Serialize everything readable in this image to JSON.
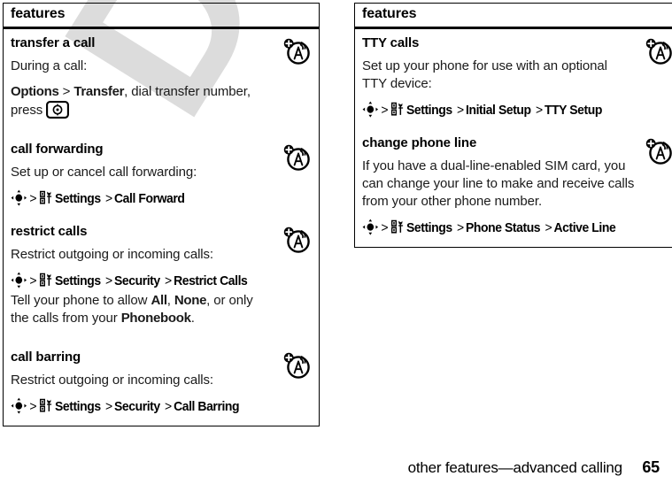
{
  "document": {
    "watermark_text": "DRAFT",
    "watermark_color": "#dcdcdc",
    "page_background": "#ffffff",
    "text_color": "#000000"
  },
  "footer": {
    "section_title": "other features—advanced calling",
    "page_number": "65"
  },
  "columns": [
    {
      "header": "features",
      "rows": [
        {
          "title": "transfer a call",
          "icon": "network-service-icon",
          "blocks": [
            {
              "kind": "para",
              "text": "During a call:"
            },
            {
              "kind": "rich",
              "segments": [
                {
                  "text": "Options",
                  "bold": true
                },
                {
                  "text": " > ",
                  "bold": false
                },
                {
                  "text": "Transfer",
                  "bold": true
                },
                {
                  "text": ", dial transfer number, press ",
                  "bold": false
                }
              ],
              "trailing_icon": "send-key-icon"
            }
          ]
        },
        {
          "title": "call forwarding",
          "icon": "network-service-icon",
          "blocks": [
            {
              "kind": "para",
              "text": "Set up or cancel call forwarding:"
            },
            {
              "kind": "path",
              "leading_icon": "nav-key-icon",
              "steps": [
                "Settings",
                "Call Forward"
              ],
              "menu_icon": "settings-icon"
            }
          ]
        },
        {
          "title": "restrict calls",
          "icon": "network-service-icon",
          "blocks": [
            {
              "kind": "para",
              "text": "Restrict outgoing or incoming calls:"
            },
            {
              "kind": "path",
              "leading_icon": "nav-key-icon",
              "steps": [
                "Settings",
                "Security",
                "Restrict Calls"
              ],
              "menu_icon": "settings-icon"
            },
            {
              "kind": "rich",
              "segments": [
                {
                  "text": "Tell your phone to allow ",
                  "bold": false
                },
                {
                  "text": "All",
                  "bold": true
                },
                {
                  "text": ", ",
                  "bold": false
                },
                {
                  "text": "None",
                  "bold": true
                },
                {
                  "text": ", or only the calls from your ",
                  "bold": false
                },
                {
                  "text": "Phonebook",
                  "bold": true
                },
                {
                  "text": ".",
                  "bold": false
                }
              ]
            }
          ]
        },
        {
          "title": "call barring",
          "icon": "network-service-icon",
          "blocks": [
            {
              "kind": "para",
              "text": "Restrict outgoing or incoming calls:"
            },
            {
              "kind": "path",
              "leading_icon": "nav-key-icon",
              "steps": [
                "Settings",
                "Security",
                "Call Barring"
              ],
              "menu_icon": "settings-icon"
            }
          ]
        }
      ]
    },
    {
      "header": "features",
      "rows": [
        {
          "title": "TTY calls",
          "icon": "network-service-icon",
          "blocks": [
            {
              "kind": "para",
              "text": "Set up your phone for use with an optional TTY device:"
            },
            {
              "kind": "path",
              "leading_icon": "nav-key-icon",
              "steps": [
                "Settings",
                "Initial Setup",
                "TTY Setup"
              ],
              "menu_icon": "settings-icon"
            }
          ]
        },
        {
          "title": "change phone line",
          "icon": "network-service-icon",
          "blocks": [
            {
              "kind": "para",
              "text": "If you have a dual-line-enabled SIM card, you can change your line to make and receive calls from your other phone number."
            },
            {
              "kind": "path",
              "leading_icon": "nav-key-icon",
              "steps": [
                "Settings",
                "Phone Status",
                "Active Line"
              ],
              "menu_icon": "settings-icon"
            }
          ]
        }
      ]
    }
  ]
}
